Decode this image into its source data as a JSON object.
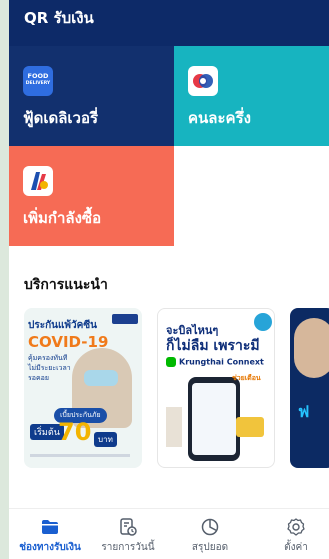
{
  "tiles": {
    "qr": {
      "label": "QR รับเงิน"
    },
    "food": {
      "label": "ฟู้ดเดลิเวอรี่",
      "icon_text": "FOOD",
      "icon_subtext": "DELIVERY"
    },
    "half_half": {
      "label": "คนละครึ่ง"
    },
    "boost": {
      "label": "เพิ่มกำลังซื้อ"
    }
  },
  "section": {
    "title": "บริการแนะนำ"
  },
  "banners": {
    "vaccine": {
      "line1": "ประกันแพ้วัคซีน",
      "line2": "COVID-19",
      "line3": "คุ้มครองทันที ไม่มีระยะเวลารอคอย",
      "pill": "เบี้ยประกันภัย",
      "start": "เริ่มต้น",
      "amount": "70",
      "unit": "บาท"
    },
    "connext": {
      "line1": "จะบิลไหนๆ",
      "line2": "ก็ไม่ลืม เพราะมี",
      "app": "Krungthai Connext",
      "help": "ช่วยเตือน"
    },
    "third": {
      "text": "ฟ"
    }
  },
  "bottom_nav": {
    "items": [
      {
        "label": "ช่องทางรับเงิน",
        "icon": "folder-icon",
        "active": true
      },
      {
        "label": "รายการวันนี้",
        "icon": "receipt-clock-icon",
        "active": false
      },
      {
        "label": "สรุปยอด",
        "icon": "pie-chart-icon",
        "active": false
      },
      {
        "label": "ตั้งค่า",
        "icon": "gear-icon",
        "active": false
      }
    ]
  },
  "colors": {
    "qr_tile": "#0d2a68",
    "food_tile": "#12306e",
    "half_half_tile": "#17b4c0",
    "boost_tile": "#f66b55",
    "active_nav": "#1a5fd0"
  }
}
